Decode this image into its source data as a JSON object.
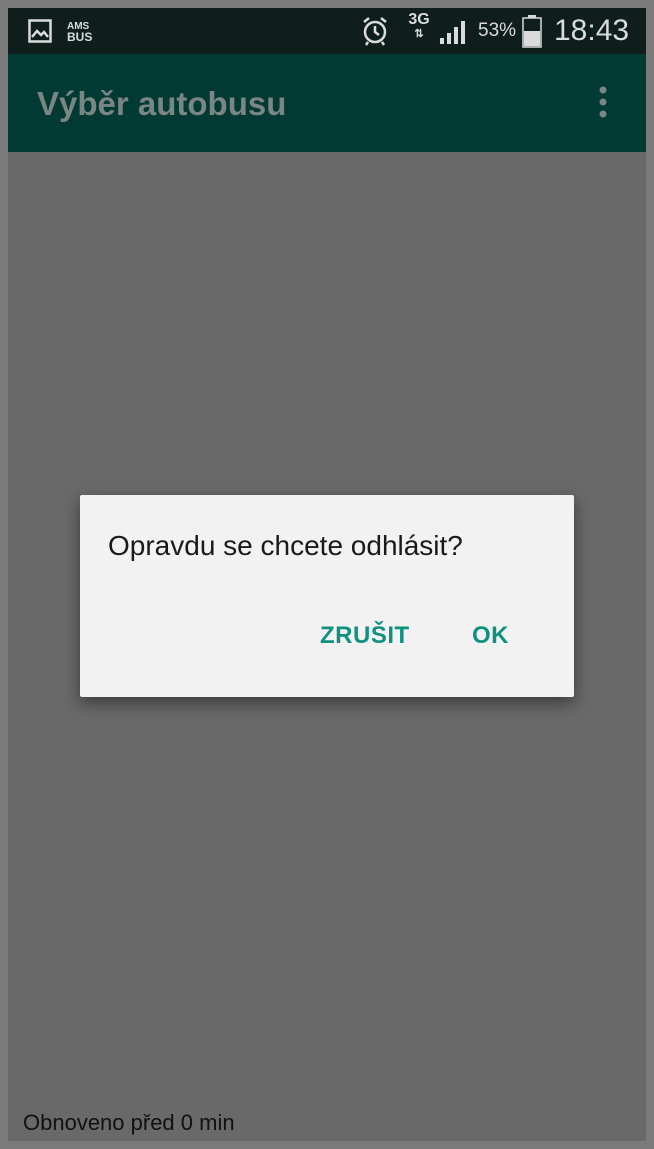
{
  "status_bar": {
    "notification_icons": [
      "gallery-icon",
      "amsbus-icon"
    ],
    "app_logo_text": "AMS BUS",
    "alarm_icon": "alarm-clock-icon",
    "network_type": "3G",
    "network_arrows": "⇅",
    "signal_icon": "signal-bars-icon",
    "battery_percent": "53%",
    "battery_icon": "battery-icon",
    "time": "18:43"
  },
  "app_bar": {
    "title": "Výběr autobusu",
    "menu_icon": "overflow-menu-icon"
  },
  "dialog": {
    "message": "Opravdu se chcete odhlásit?",
    "cancel_label": "ZRUŠIT",
    "ok_label": "OK"
  },
  "footer": {
    "refresh_status": "Obnoveno před 0 min"
  },
  "colors": {
    "status_bar_bg": "#0f1e1a",
    "app_bar_bg_dimmed": "#003a33",
    "scrim_bg": "#696969",
    "dialog_bg": "#f2f2f2",
    "accent": "#10917f"
  }
}
